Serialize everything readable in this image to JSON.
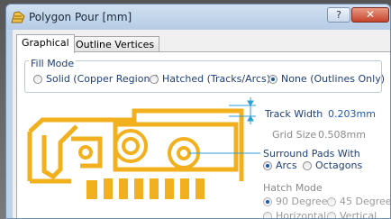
{
  "window": {
    "title": "Polygon Pour [mm]",
    "help_label": "?",
    "close_label": "✕"
  },
  "tabs": [
    {
      "label": "Graphical",
      "active": true
    },
    {
      "label": "Outline Vertices",
      "active": false
    }
  ],
  "fill_mode": {
    "title": "Fill Mode",
    "options": [
      {
        "label": "Solid (Copper Regions)",
        "selected": false
      },
      {
        "label": "Hatched (Tracks/Arcs)",
        "selected": false
      },
      {
        "label": "None (Outlines Only)",
        "selected": true
      }
    ]
  },
  "track_width": {
    "label": "Track Width",
    "value": "0.203mm"
  },
  "grid_size": {
    "label": "Grid Size",
    "value": "0.508mm"
  },
  "surround_pads": {
    "title": "Surround Pads With",
    "options": [
      {
        "label": "Arcs",
        "selected": true
      },
      {
        "label": "Octagons",
        "selected": false
      }
    ]
  },
  "hatch_mode": {
    "title": "Hatch Mode",
    "enabled": false,
    "options": [
      {
        "label": "90 Degree",
        "selected": true
      },
      {
        "label": "45 Degree",
        "selected": false
      },
      {
        "label": "Horizontal",
        "selected": false
      },
      {
        "label": "Vertical",
        "selected": false
      }
    ]
  },
  "colors": {
    "copper": "#f2b01e",
    "dimension": "#2a9fd8",
    "title_blue": "#1f3e7a"
  },
  "icons": {
    "app": "polygon-pour-icon"
  }
}
